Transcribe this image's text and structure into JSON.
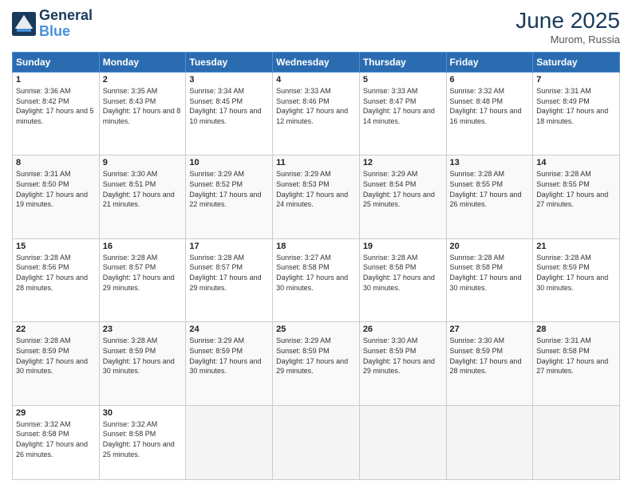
{
  "header": {
    "logo_line1": "General",
    "logo_line2": "Blue",
    "month": "June 2025",
    "location": "Murom, Russia"
  },
  "weekdays": [
    "Sunday",
    "Monday",
    "Tuesday",
    "Wednesday",
    "Thursday",
    "Friday",
    "Saturday"
  ],
  "weeks": [
    [
      {
        "day": "1",
        "sunrise": "Sunrise: 3:36 AM",
        "sunset": "Sunset: 8:42 PM",
        "daylight": "Daylight: 17 hours and 5 minutes."
      },
      {
        "day": "2",
        "sunrise": "Sunrise: 3:35 AM",
        "sunset": "Sunset: 8:43 PM",
        "daylight": "Daylight: 17 hours and 8 minutes."
      },
      {
        "day": "3",
        "sunrise": "Sunrise: 3:34 AM",
        "sunset": "Sunset: 8:45 PM",
        "daylight": "Daylight: 17 hours and 10 minutes."
      },
      {
        "day": "4",
        "sunrise": "Sunrise: 3:33 AM",
        "sunset": "Sunset: 8:46 PM",
        "daylight": "Daylight: 17 hours and 12 minutes."
      },
      {
        "day": "5",
        "sunrise": "Sunrise: 3:33 AM",
        "sunset": "Sunset: 8:47 PM",
        "daylight": "Daylight: 17 hours and 14 minutes."
      },
      {
        "day": "6",
        "sunrise": "Sunrise: 3:32 AM",
        "sunset": "Sunset: 8:48 PM",
        "daylight": "Daylight: 17 hours and 16 minutes."
      },
      {
        "day": "7",
        "sunrise": "Sunrise: 3:31 AM",
        "sunset": "Sunset: 8:49 PM",
        "daylight": "Daylight: 17 hours and 18 minutes."
      }
    ],
    [
      {
        "day": "8",
        "sunrise": "Sunrise: 3:31 AM",
        "sunset": "Sunset: 8:50 PM",
        "daylight": "Daylight: 17 hours and 19 minutes."
      },
      {
        "day": "9",
        "sunrise": "Sunrise: 3:30 AM",
        "sunset": "Sunset: 8:51 PM",
        "daylight": "Daylight: 17 hours and 21 minutes."
      },
      {
        "day": "10",
        "sunrise": "Sunrise: 3:29 AM",
        "sunset": "Sunset: 8:52 PM",
        "daylight": "Daylight: 17 hours and 22 minutes."
      },
      {
        "day": "11",
        "sunrise": "Sunrise: 3:29 AM",
        "sunset": "Sunset: 8:53 PM",
        "daylight": "Daylight: 17 hours and 24 minutes."
      },
      {
        "day": "12",
        "sunrise": "Sunrise: 3:29 AM",
        "sunset": "Sunset: 8:54 PM",
        "daylight": "Daylight: 17 hours and 25 minutes."
      },
      {
        "day": "13",
        "sunrise": "Sunrise: 3:28 AM",
        "sunset": "Sunset: 8:55 PM",
        "daylight": "Daylight: 17 hours and 26 minutes."
      },
      {
        "day": "14",
        "sunrise": "Sunrise: 3:28 AM",
        "sunset": "Sunset: 8:55 PM",
        "daylight": "Daylight: 17 hours and 27 minutes."
      }
    ],
    [
      {
        "day": "15",
        "sunrise": "Sunrise: 3:28 AM",
        "sunset": "Sunset: 8:56 PM",
        "daylight": "Daylight: 17 hours and 28 minutes."
      },
      {
        "day": "16",
        "sunrise": "Sunrise: 3:28 AM",
        "sunset": "Sunset: 8:57 PM",
        "daylight": "Daylight: 17 hours and 29 minutes."
      },
      {
        "day": "17",
        "sunrise": "Sunrise: 3:28 AM",
        "sunset": "Sunset: 8:57 PM",
        "daylight": "Daylight: 17 hours and 29 minutes."
      },
      {
        "day": "18",
        "sunrise": "Sunrise: 3:27 AM",
        "sunset": "Sunset: 8:58 PM",
        "daylight": "Daylight: 17 hours and 30 minutes."
      },
      {
        "day": "19",
        "sunrise": "Sunrise: 3:28 AM",
        "sunset": "Sunset: 8:58 PM",
        "daylight": "Daylight: 17 hours and 30 minutes."
      },
      {
        "day": "20",
        "sunrise": "Sunrise: 3:28 AM",
        "sunset": "Sunset: 8:58 PM",
        "daylight": "Daylight: 17 hours and 30 minutes."
      },
      {
        "day": "21",
        "sunrise": "Sunrise: 3:28 AM",
        "sunset": "Sunset: 8:59 PM",
        "daylight": "Daylight: 17 hours and 30 minutes."
      }
    ],
    [
      {
        "day": "22",
        "sunrise": "Sunrise: 3:28 AM",
        "sunset": "Sunset: 8:59 PM",
        "daylight": "Daylight: 17 hours and 30 minutes."
      },
      {
        "day": "23",
        "sunrise": "Sunrise: 3:28 AM",
        "sunset": "Sunset: 8:59 PM",
        "daylight": "Daylight: 17 hours and 30 minutes."
      },
      {
        "day": "24",
        "sunrise": "Sunrise: 3:29 AM",
        "sunset": "Sunset: 8:59 PM",
        "daylight": "Daylight: 17 hours and 30 minutes."
      },
      {
        "day": "25",
        "sunrise": "Sunrise: 3:29 AM",
        "sunset": "Sunset: 8:59 PM",
        "daylight": "Daylight: 17 hours and 29 minutes."
      },
      {
        "day": "26",
        "sunrise": "Sunrise: 3:30 AM",
        "sunset": "Sunset: 8:59 PM",
        "daylight": "Daylight: 17 hours and 29 minutes."
      },
      {
        "day": "27",
        "sunrise": "Sunrise: 3:30 AM",
        "sunset": "Sunset: 8:59 PM",
        "daylight": "Daylight: 17 hours and 28 minutes."
      },
      {
        "day": "28",
        "sunrise": "Sunrise: 3:31 AM",
        "sunset": "Sunset: 8:58 PM",
        "daylight": "Daylight: 17 hours and 27 minutes."
      }
    ],
    [
      {
        "day": "29",
        "sunrise": "Sunrise: 3:32 AM",
        "sunset": "Sunset: 8:58 PM",
        "daylight": "Daylight: 17 hours and 26 minutes."
      },
      {
        "day": "30",
        "sunrise": "Sunrise: 3:32 AM",
        "sunset": "Sunset: 8:58 PM",
        "daylight": "Daylight: 17 hours and 25 minutes."
      },
      null,
      null,
      null,
      null,
      null
    ]
  ]
}
